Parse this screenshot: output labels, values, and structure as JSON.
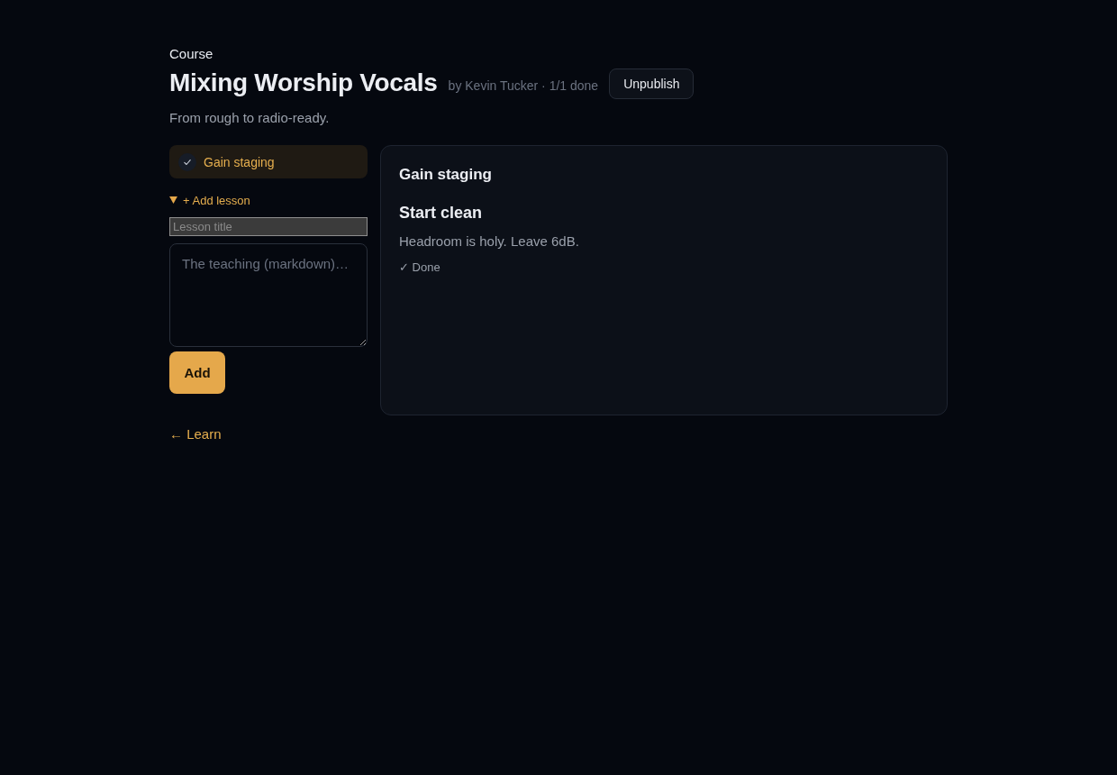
{
  "header": {
    "eyebrow": "Course",
    "title": "Mixing Worship Vocals",
    "meta": "by Kevin Tucker · 1/1 done",
    "action_button": "Unpublish",
    "subtitle": "From rough to radio-ready."
  },
  "lessons": [
    {
      "title": "Gain staging",
      "done": true,
      "selected": true
    }
  ],
  "add_lesson": {
    "label": "+ Add lesson",
    "expanded": true,
    "title_field": {
      "placeholder": "Lesson title"
    },
    "body_field": {
      "placeholder": "The teaching (markdown)…"
    },
    "button": "Add"
  },
  "lesson_view": {
    "lesson_title": "Gain staging",
    "heading": "Start clean",
    "body": "Headroom is holy. Leave 6dB.",
    "status": "✓ Done"
  },
  "back_link": "← Learn"
}
